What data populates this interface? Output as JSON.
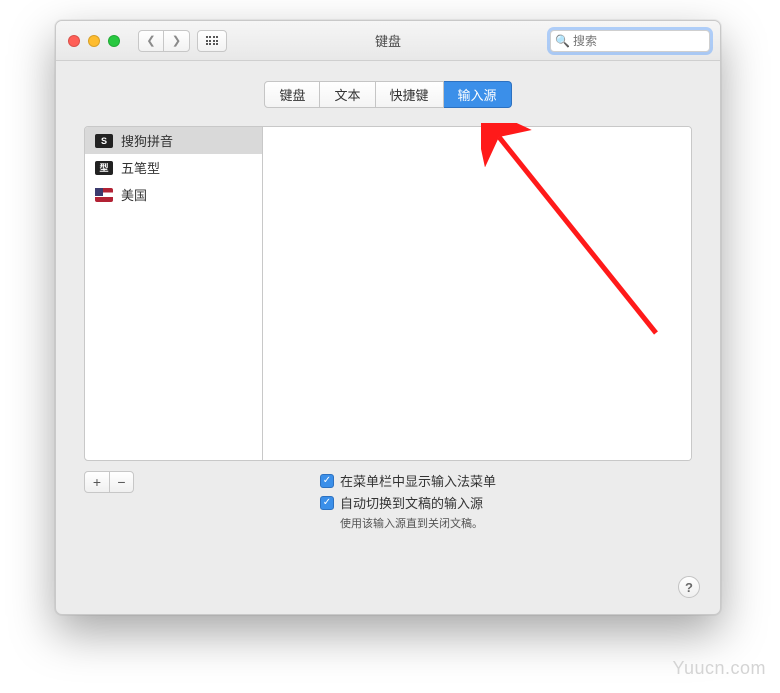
{
  "window": {
    "title": "键盘"
  },
  "search": {
    "placeholder": "搜索"
  },
  "tabs": [
    {
      "label": "键盘",
      "active": false
    },
    {
      "label": "文本",
      "active": false
    },
    {
      "label": "快捷键",
      "active": false
    },
    {
      "label": "输入源",
      "active": true
    }
  ],
  "input_sources": [
    {
      "label": "搜狗拼音",
      "icon": "sougou",
      "selected": true
    },
    {
      "label": "五笔型",
      "icon": "wubi",
      "selected": false
    },
    {
      "label": "美国",
      "icon": "us-flag",
      "selected": false
    }
  ],
  "controls": {
    "add": "+",
    "remove": "−"
  },
  "checkboxes": {
    "show_menu": {
      "label": "在菜单栏中显示输入法菜单",
      "checked": true
    },
    "auto_switch": {
      "label": "自动切换到文稿的输入源",
      "checked": true
    },
    "hint": "使用该输入源直到关闭文稿。"
  },
  "help": "?",
  "watermark": "Yuucn.com"
}
